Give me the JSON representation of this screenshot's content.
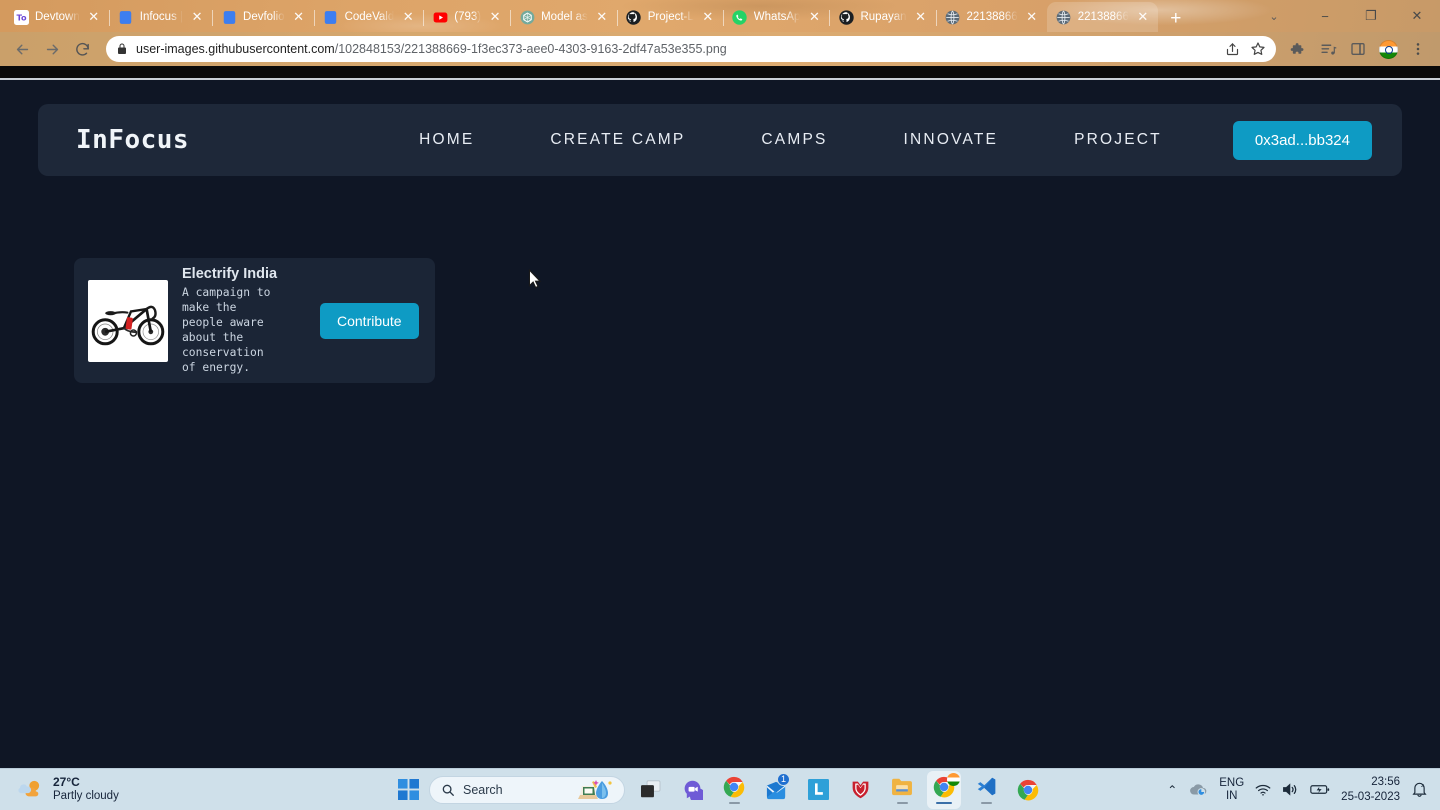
{
  "browser": {
    "tabs": [
      {
        "title": "Devtown",
        "icon": "devtown-icon"
      },
      {
        "title": "Infocus |",
        "icon": "blue-doc-icon"
      },
      {
        "title": "Devfolio",
        "icon": "blue-doc-icon"
      },
      {
        "title": "CodeVald",
        "icon": "blue-doc-icon"
      },
      {
        "title": "(793)",
        "icon": "youtube-icon"
      },
      {
        "title": "Model as",
        "icon": "openai-icon"
      },
      {
        "title": "Project-L",
        "icon": "github-icon"
      },
      {
        "title": "WhatsAp",
        "icon": "whatsapp-icon"
      },
      {
        "title": "Rupayan",
        "icon": "github-icon"
      },
      {
        "title": "22138866",
        "icon": "globe-icon"
      },
      {
        "title": "22138866",
        "icon": "globe-icon"
      }
    ],
    "active_tab_index": 10,
    "new_tab_label": "+",
    "close_label": "✕",
    "window_controls": {
      "chevron": "⌄",
      "minimize": "−",
      "maximize": "❐",
      "close": "✕"
    },
    "toolbar": {
      "back": "←",
      "forward": "→",
      "reload": "⟳",
      "lock_icon": "lock-icon",
      "url_host": "user-images.githubusercontent.com",
      "url_path": "/102848153/221388669-1f3ec373-aee0-4303-9163-2df47a53e355.png",
      "share_icon": "share-icon",
      "bookmark_icon": "star-icon",
      "extensions_icon": "puzzle-icon",
      "reading_list_icon": "reading-list-icon",
      "side_panel_icon": "side-panel-icon",
      "profile_icon": "profile-avatar",
      "menu_icon": "kebab-menu-icon"
    }
  },
  "site": {
    "brand": "InFocus",
    "nav": [
      {
        "label": "HOME"
      },
      {
        "label": "CREATE CAMP"
      },
      {
        "label": "CAMPS"
      },
      {
        "label": "INNOVATE"
      },
      {
        "label": "PROJECT"
      }
    ],
    "wallet_label": "0x3ad...bb324",
    "accent_color": "#0e9bc4",
    "navbar_color": "#1e2839",
    "page_background": "#0f1625",
    "card": {
      "image_alt": "electric-folding-bike",
      "title": "Electrify India",
      "description": "A campaign to make the people aware about the conservation of energy.",
      "button_label": "Contribute"
    }
  },
  "taskbar": {
    "weather": {
      "temperature": "27°C",
      "condition": "Partly cloudy",
      "icon": "partly-cloudy-icon"
    },
    "start_icon": "windows-start-icon",
    "search_placeholder": "Search",
    "apps": [
      {
        "name": "task-view",
        "icon": "task-view-icon"
      },
      {
        "name": "chat",
        "icon": "teams-chat-icon"
      },
      {
        "name": "chrome",
        "icon": "chrome-icon"
      },
      {
        "name": "mail",
        "icon": "mail-icon",
        "badge": "1"
      },
      {
        "name": "linkedin",
        "icon": "linkedin-icon"
      },
      {
        "name": "mcafee",
        "icon": "mcafee-shield-icon"
      },
      {
        "name": "file-explorer",
        "icon": "folder-icon"
      },
      {
        "name": "chrome-active",
        "icon": "chrome-icon"
      },
      {
        "name": "vs-code",
        "icon": "vscode-icon"
      },
      {
        "name": "chrome-2",
        "icon": "chrome-icon"
      }
    ],
    "tray": {
      "overflow": "⌃",
      "cloud_icon": "onedrive-icon",
      "language": "ENG",
      "region": "IN",
      "wifi_icon": "wifi-icon",
      "volume_icon": "volume-icon",
      "battery_icon": "battery-icon",
      "time": "23:56",
      "date": "25-03-2023",
      "notifications_icon": "bell-icon"
    }
  }
}
